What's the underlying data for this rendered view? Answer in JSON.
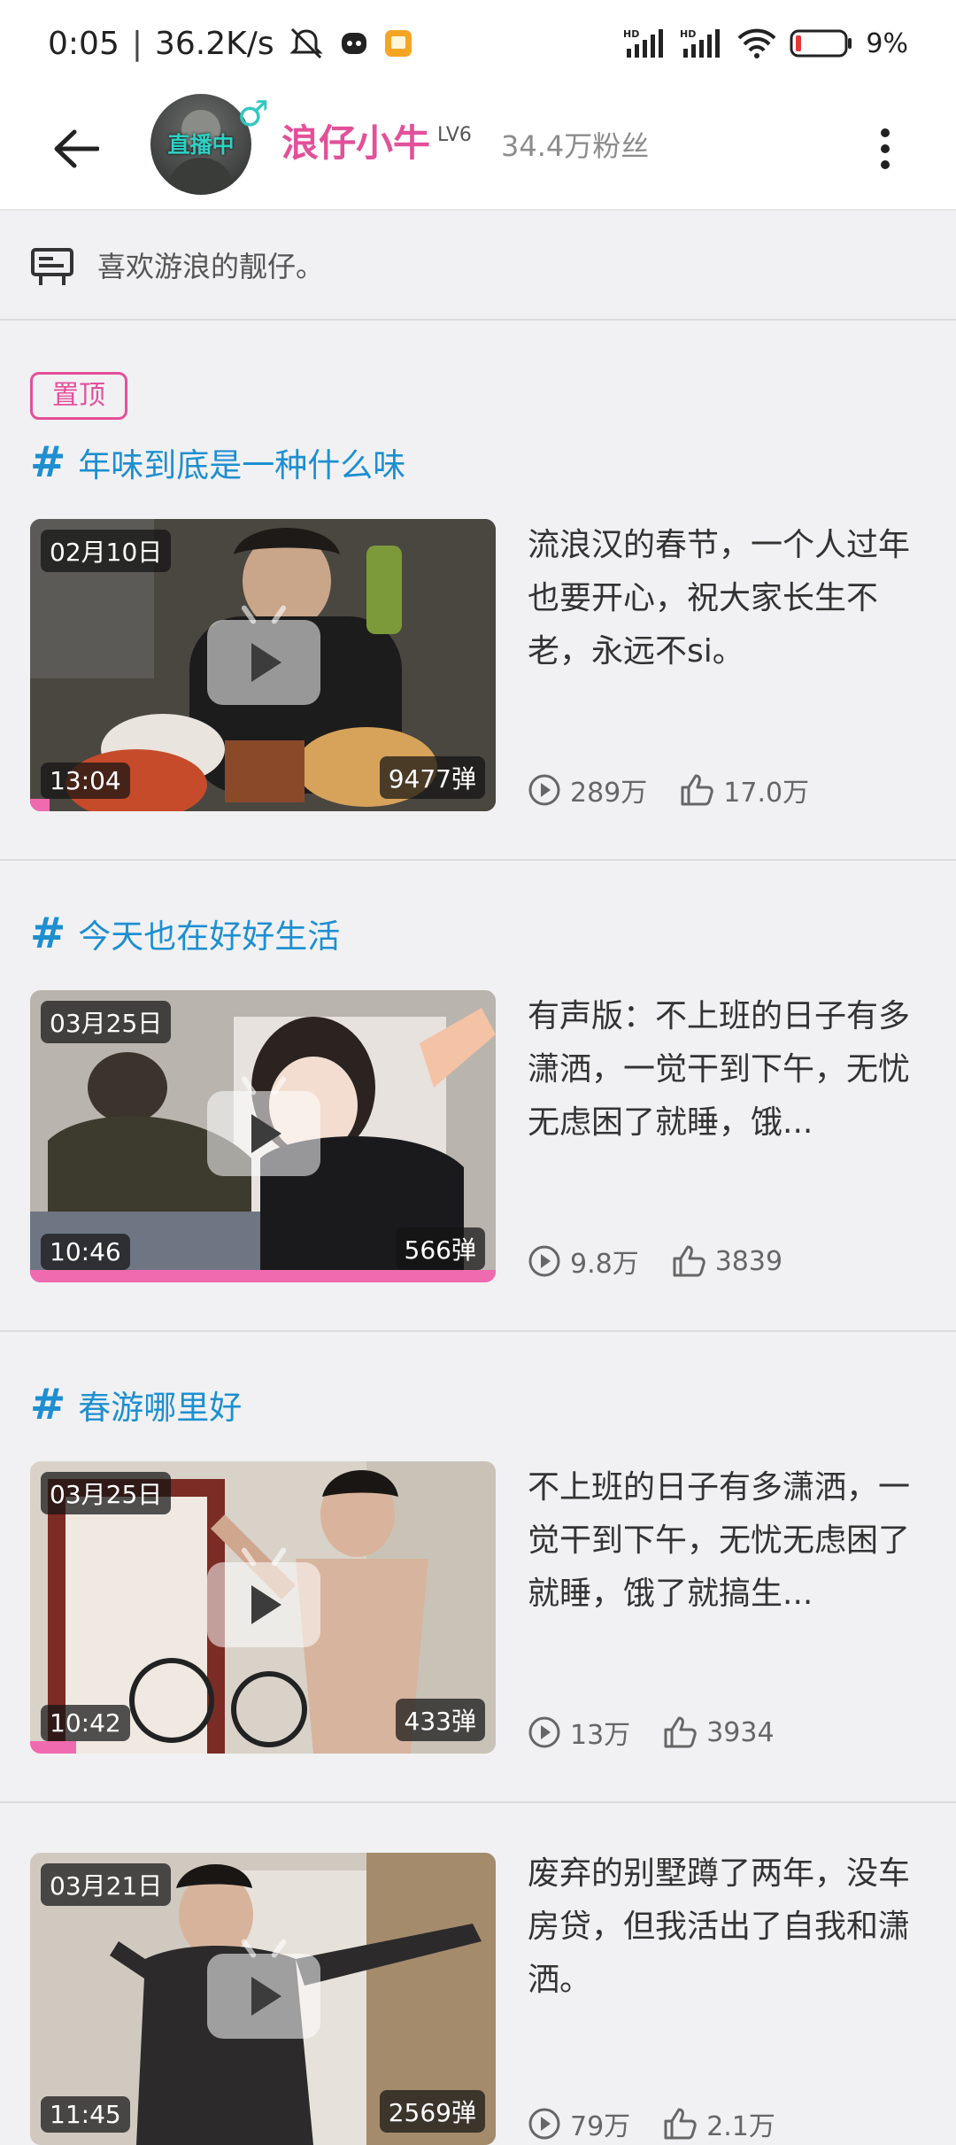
{
  "status_bar": {
    "time": "0:05",
    "speed": "36.2K/s",
    "battery": "9%"
  },
  "header": {
    "live_label": "直播中",
    "username": "浪仔小牛",
    "level": "LV6",
    "fans": "34.4万粉丝"
  },
  "notice": {
    "text": "喜欢游浪的靓仔。"
  },
  "feed": {
    "pinned_label": "置顶",
    "items": [
      {
        "topic": "年味到底是一种什么味",
        "date": "02月10日",
        "duration": "13:04",
        "danmaku": "9477弹",
        "description": "流浪汉的春节，一个人过年也要开心，祝大家长生不老，永远不si。",
        "views": "289万",
        "likes": "17.0万",
        "progress": 0.04
      },
      {
        "topic": "今天也在好好生活",
        "date": "03月25日",
        "duration": "10:46",
        "danmaku": "566弹",
        "description": "有声版：不上班的日子有多潇洒，一觉干到下午，无忧无虑困了就睡，饿...",
        "views": "9.8万",
        "likes": "3839",
        "progress": 1.0
      },
      {
        "topic": "春游哪里好",
        "date": "03月25日",
        "duration": "10:42",
        "danmaku": "433弹",
        "description": "不上班的日子有多潇洒，一觉干到下午，无忧无虑困了就睡，饿了就搞生...",
        "views": "13万",
        "likes": "3934",
        "progress": 0.1
      },
      {
        "topic": "",
        "date": "03月21日",
        "duration": "11:45",
        "danmaku": "2569弹",
        "description": "废弃的别墅蹲了两年，没车房贷，但我活出了自我和潇洒。",
        "views": "79万",
        "likes": "2.1万",
        "progress": 0
      }
    ]
  },
  "colors": {
    "accent_pink": "#e3509a",
    "topic_blue": "#1e8fd0",
    "live_teal": "#2fd0c4"
  }
}
